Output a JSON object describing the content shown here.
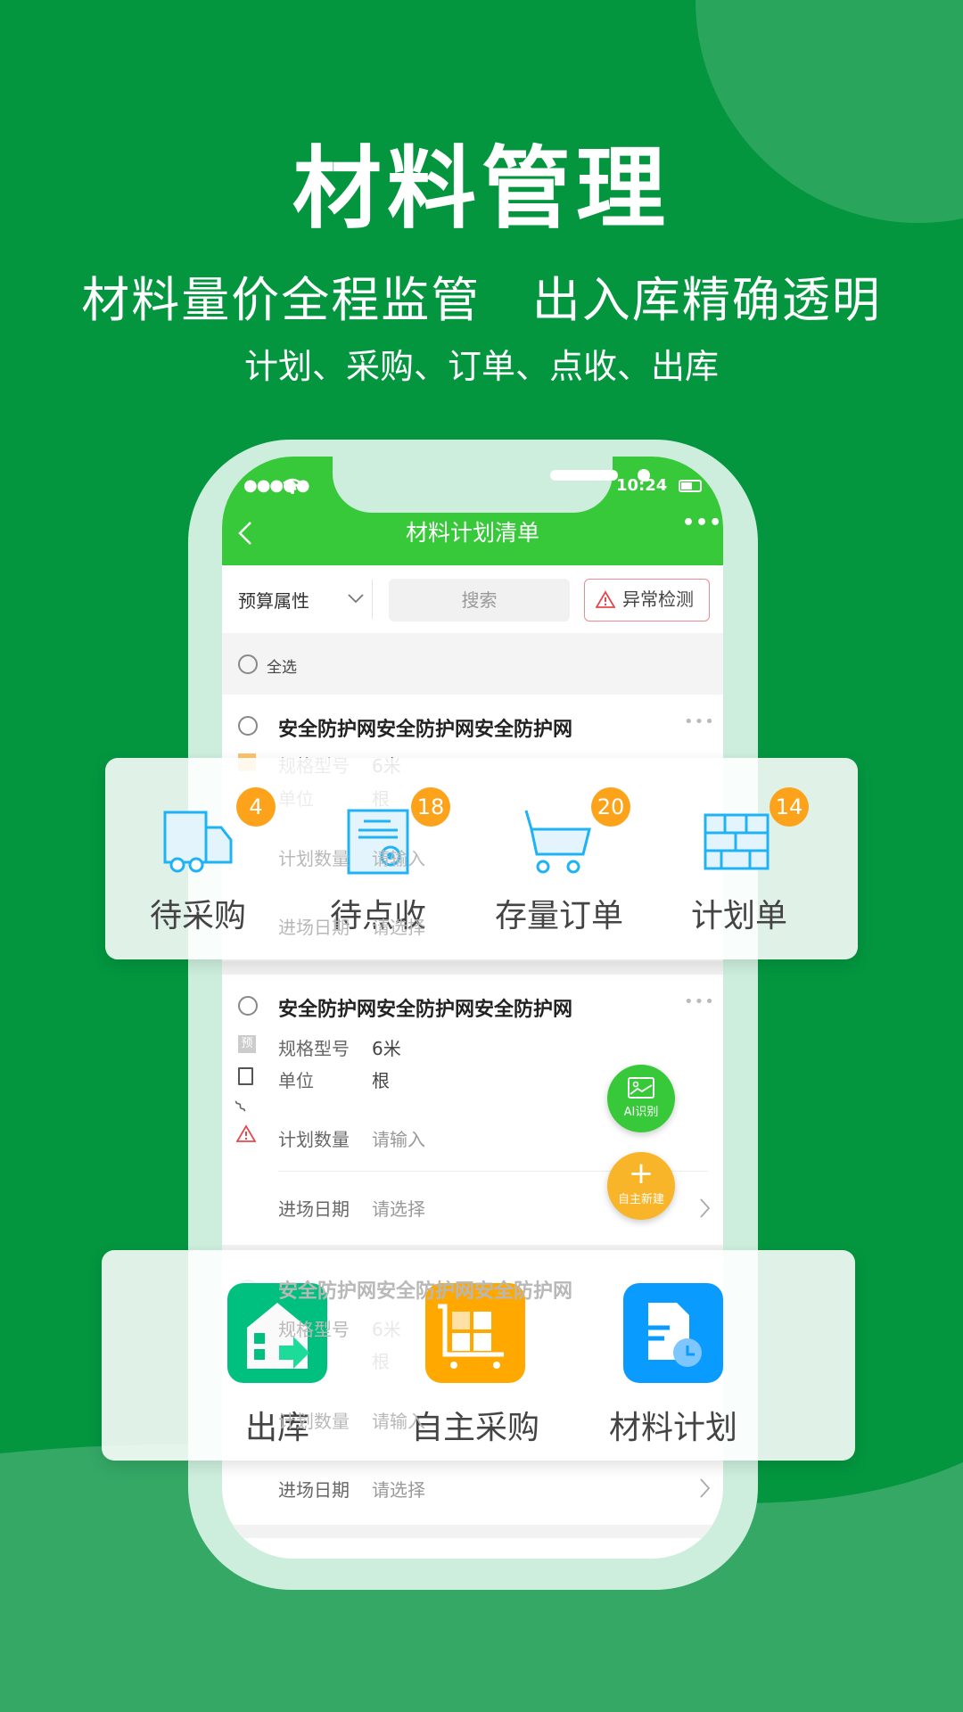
{
  "hero": {
    "title": "材料管理",
    "subtitle": "材料量价全程监管   出入库精确透明",
    "tagline": "计划、采购、订单、点收、出库"
  },
  "colors": {
    "background": "#03963f",
    "header": "#38c93a",
    "badge": "#fda31b",
    "icon_blue": "#1fb3f5",
    "danger": "#e5484d"
  },
  "status_bar": {
    "time": "10:24"
  },
  "nav": {
    "title": "材料计划清单",
    "back_icon": "chevron-left-icon",
    "more_icon": "more-icon"
  },
  "filter": {
    "budget_select": "预算属性",
    "search_placeholder": "搜索",
    "anomaly_button": "异常检测"
  },
  "select_all": "全选",
  "items": [
    {
      "title": "安全防护网安全防护网安全防护网",
      "spec_label": "规格型号",
      "spec": "6米",
      "unit_label": "单位",
      "unit": "根",
      "qty_label": "计划数量",
      "qty_placeholder": "请输入",
      "date_label": "进场日期",
      "date_placeholder": "请选择"
    },
    {
      "title": "安全防护网安全防护网安全防护网",
      "spec_label": "规格型号",
      "spec": "6米",
      "unit_label": "单位",
      "unit": "根",
      "qty_label": "计划数量",
      "qty_placeholder": "请输入",
      "date_label": "进场日期",
      "date_placeholder": "请选择",
      "tag": "预"
    },
    {
      "title": "安全防护网安全防护网安全防护网",
      "spec_label": "规格型号",
      "spec": "6米",
      "unit_label": "单位",
      "unit": "根",
      "qty_label": "计划数量",
      "qty_placeholder": "请输入",
      "date_label": "进场日期",
      "date_placeholder": "请选择"
    }
  ],
  "fabs": {
    "ai": "AI识别",
    "create": "自主新建"
  },
  "stats": [
    {
      "label": "待采购",
      "count": "4",
      "icon": "truck-icon"
    },
    {
      "label": "待点收",
      "count": "18",
      "icon": "certificate-icon"
    },
    {
      "label": "存量订单",
      "count": "20",
      "icon": "cart-icon"
    },
    {
      "label": "计划单",
      "count": "14",
      "icon": "brick-wall-icon"
    }
  ],
  "shortcuts": [
    {
      "label": "出库",
      "icon": "warehouse-out-icon",
      "color": "#00c07f"
    },
    {
      "label": "自主采购",
      "icon": "shopping-cart-icon",
      "color": "#ffa800"
    },
    {
      "label": "材料计划",
      "icon": "document-clock-icon",
      "color": "#0a9bff"
    }
  ]
}
